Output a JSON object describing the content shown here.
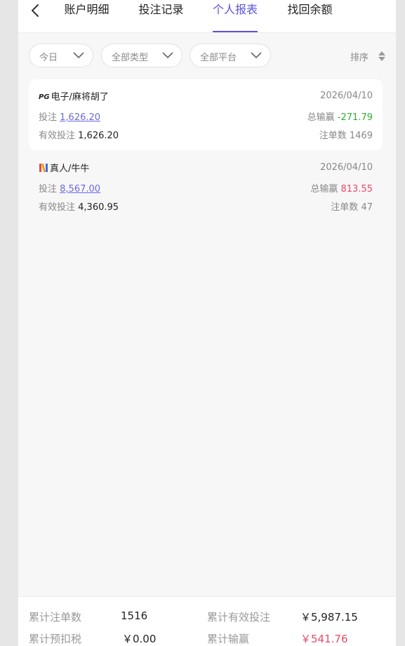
{
  "header": {
    "tabs": [
      {
        "label": "账户明细",
        "active": false
      },
      {
        "label": "投注记录",
        "active": false
      },
      {
        "label": "个人报表",
        "active": true
      },
      {
        "label": "找回余额",
        "active": false
      }
    ]
  },
  "filters": {
    "date": "今日",
    "type": "全部类型",
    "platform": "全部平台",
    "sort": "排序"
  },
  "records": [
    {
      "provider_badge": "PG",
      "game": "电子/麻将胡了",
      "date": "2026/04/10",
      "bet_label": "投注",
      "bet": "1,626.20",
      "winloss_label": "总输赢",
      "winloss": "-271.79",
      "valid_label": "有效投注",
      "valid": "1,626.20",
      "orders_label": "注单数",
      "orders": "1469"
    },
    {
      "provider_badge": "",
      "game": "真人/牛牛",
      "date": "2026/04/10",
      "bet_label": "投注",
      "bet": "8,567.00",
      "winloss_label": "总输赢",
      "winloss": "813.55",
      "valid_label": "有效投注",
      "valid": "4,360.95",
      "orders_label": "注单数",
      "orders": "47"
    }
  ],
  "summary": {
    "total_orders_label": "累计注单数",
    "total_orders": "1516",
    "total_valid_label": "累计有效投注",
    "total_valid": "￥5,987.15",
    "total_tax_label": "累计预扣税",
    "total_tax": "￥0.00",
    "total_winloss_label": "累计输赢",
    "total_winloss": "￥541.76"
  },
  "colors": {
    "accent": "#5b52d9",
    "loss": "#2fae2f",
    "win": "#e94a6a"
  }
}
